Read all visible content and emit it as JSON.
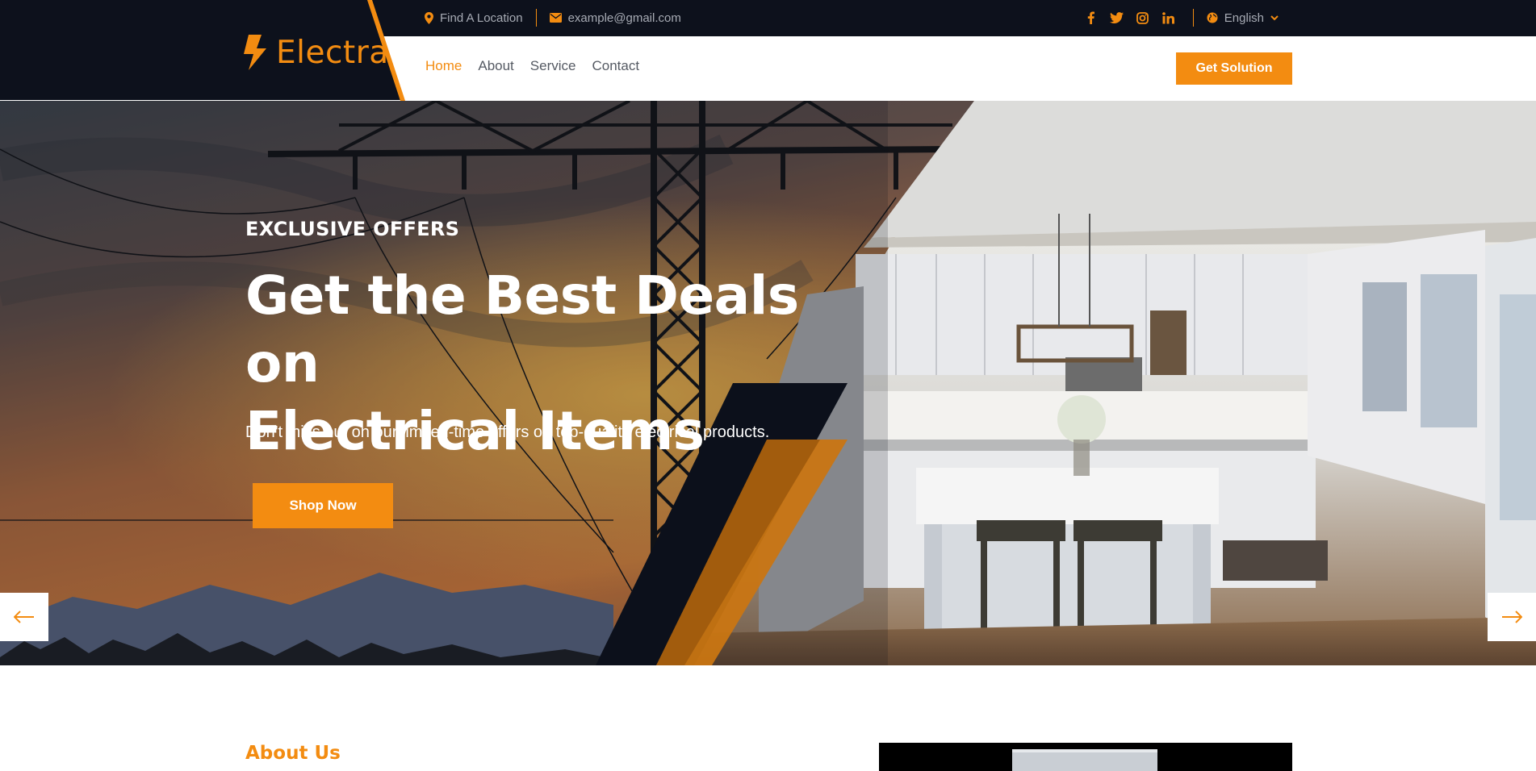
{
  "brand": {
    "name": "Electra",
    "accent": "#f38c11",
    "dark": "#0d111c"
  },
  "topbar": {
    "location": "Find A Location",
    "email": "example@gmail.com",
    "social_icons": [
      "facebook-icon",
      "twitter-icon",
      "instagram-icon",
      "linkedin-icon"
    ],
    "language": "English"
  },
  "nav": {
    "links": [
      {
        "label": "Home",
        "active": true
      },
      {
        "label": "About",
        "active": false
      },
      {
        "label": "Service",
        "active": false
      },
      {
        "label": "Contact",
        "active": false
      }
    ],
    "cta": "Get Solution"
  },
  "hero": {
    "eyebrow": "EXCLUSIVE OFFERS",
    "title_line1": "Get the Best Deals on",
    "title_line2": "Electrical Items",
    "subtitle": "Don't miss out on our limited-time offers on top-quality electrical products.",
    "button": "Shop Now"
  },
  "about": {
    "title": "About Us"
  }
}
